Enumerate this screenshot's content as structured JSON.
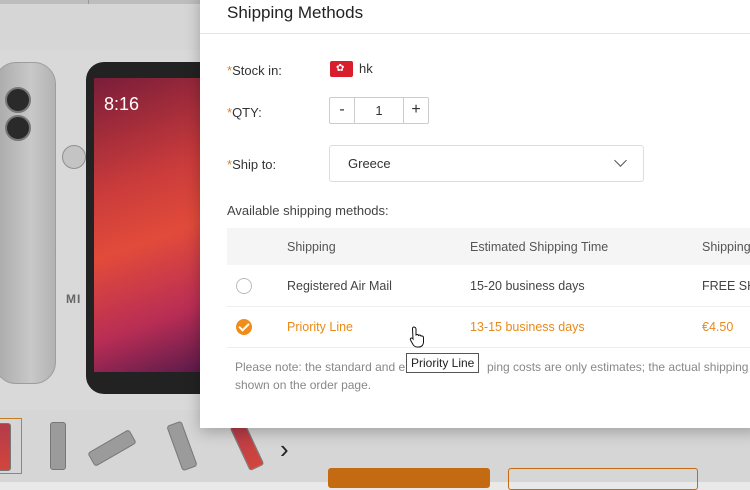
{
  "modal": {
    "title": "Shipping Methods",
    "stock": {
      "required": "*",
      "label": "Stock in:",
      "value": "hk"
    },
    "qty": {
      "required": "*",
      "label": "QTY:",
      "minus": "-",
      "value": "1",
      "plus": "+"
    },
    "ship_to": {
      "required": "*",
      "label": "Ship to:",
      "value": "Greece"
    },
    "available_label": "Available shipping methods:",
    "table": {
      "headers": [
        "Shipping",
        "Estimated Shipping Time",
        "Shipping"
      ],
      "rows": [
        {
          "method": "Registered Air Mail",
          "time": "15-20 business days",
          "cost": "FREE SHI",
          "selected": false
        },
        {
          "method": "Priority Line",
          "time": "13-15 business days",
          "cost": "€4.50",
          "selected": true
        }
      ]
    },
    "note": {
      "line1_start": "Please note: the standard and e",
      "line1_end": "ping costs are only estimates; the actual shipping",
      "line2": "shown on the order page."
    }
  },
  "tooltip": "Priority Line",
  "background": {
    "phone_clock": "8:16",
    "phone_brand": "MI",
    "next_arrow": "›"
  },
  "colors": {
    "accent": "#f08c1a",
    "required": "#e67e22",
    "flag": "#d81e2c"
  }
}
